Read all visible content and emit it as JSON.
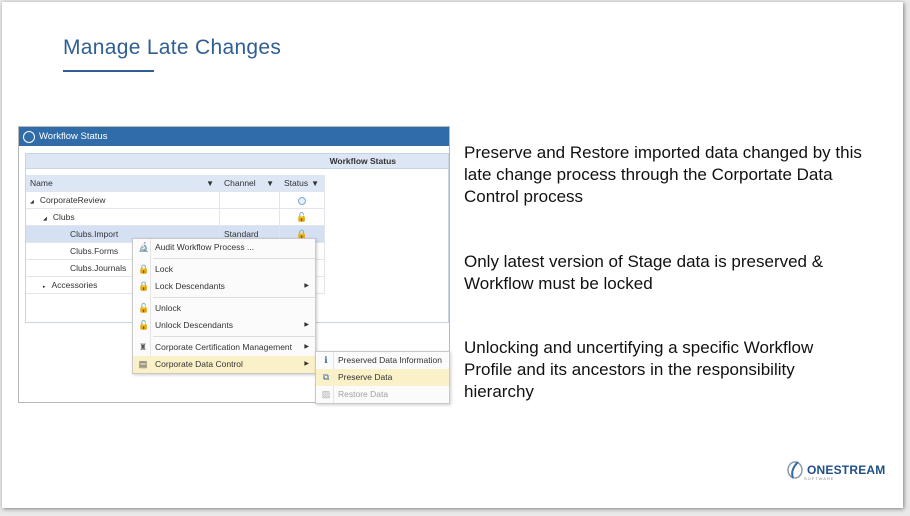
{
  "slide": {
    "title": "Manage Late Changes"
  },
  "window": {
    "title": "Workflow Status",
    "group_header": "Workflow Status",
    "columns": [
      "Name",
      "Channel",
      "Status"
    ],
    "rows": [
      {
        "name": "CorporateReview",
        "channel": "",
        "status_icon": "circle-icon",
        "expander": "expanded",
        "level": 0
      },
      {
        "name": "Clubs",
        "channel": "",
        "status_icon": "lock-icon",
        "expander": "expanded",
        "level": 1
      },
      {
        "name": "Clubs.Import",
        "channel": "Standard",
        "status_icon": "lock-check-icon",
        "expander": "",
        "level": 2,
        "selected": true
      },
      {
        "name": "Clubs.Forms",
        "channel": "",
        "status_icon": "",
        "expander": "",
        "level": 2
      },
      {
        "name": "Clubs.Journals",
        "channel": "",
        "status_icon": "",
        "expander": "",
        "level": 2
      },
      {
        "name": "Accessories",
        "channel": "",
        "status_icon": "",
        "expander": "collapsed",
        "level": 1
      }
    ]
  },
  "context_menu": {
    "items": [
      {
        "label": "Audit Workflow Process ...",
        "icon": "microscope-icon"
      },
      {
        "label": "Lock",
        "icon": "lock-red-icon"
      },
      {
        "label": "Lock Descendants",
        "icon": "lock-descendants-icon",
        "submenu": true
      },
      {
        "label": "Unlock",
        "icon": "unlock-green-icon"
      },
      {
        "label": "Unlock Descendants",
        "icon": "unlock-descendants-icon",
        "submenu": true
      },
      {
        "label": "Corporate Certification Management",
        "icon": "certification-icon",
        "submenu": true
      },
      {
        "label": "Corporate Data Control",
        "icon": "data-control-icon",
        "submenu": true,
        "highlighted": true
      }
    ]
  },
  "submenu": {
    "items": [
      {
        "label": "Preserved Data Information",
        "icon": "info-icon"
      },
      {
        "label": "Preserve Data",
        "icon": "preserve-icon",
        "highlighted": true
      },
      {
        "label": "Restore Data",
        "icon": "restore-icon",
        "disabled": true
      }
    ]
  },
  "bullets": [
    "Preserve and Restore imported data changed by this late change process through the Corportate Data Control process",
    "Only latest version of Stage data is preserved & Workflow must be locked",
    "Unlocking and uncertifying a specific Workflow Profile and its ancestors in the responsibility hierarchy"
  ],
  "brand": {
    "name": "ONESTREAM",
    "tagline": "SOFTWARE"
  },
  "colors": {
    "accent": "#2f5f92",
    "titlebar": "#2f6ca8",
    "highlight": "#fbf1c8"
  }
}
